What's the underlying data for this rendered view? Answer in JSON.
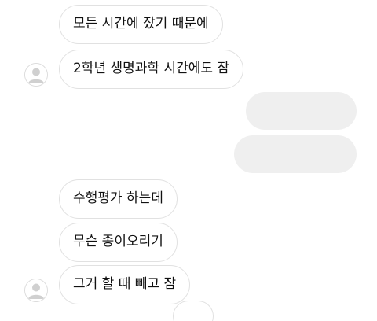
{
  "messages": {
    "m1": "모든 시간에 잤기 때문에",
    "m2": "2학년 생명과학 시간에도 잠",
    "m3": "수행평가 하는데",
    "m4": "무슨 종이오리기",
    "m5": "그거 할 때 빼고 잠"
  },
  "icons": {
    "avatar": "user-avatar-icon"
  },
  "colors": {
    "incoming_border": "#e1e1e1",
    "outgoing_background": "#efefef",
    "avatar_fill": "#d0d0d0"
  }
}
